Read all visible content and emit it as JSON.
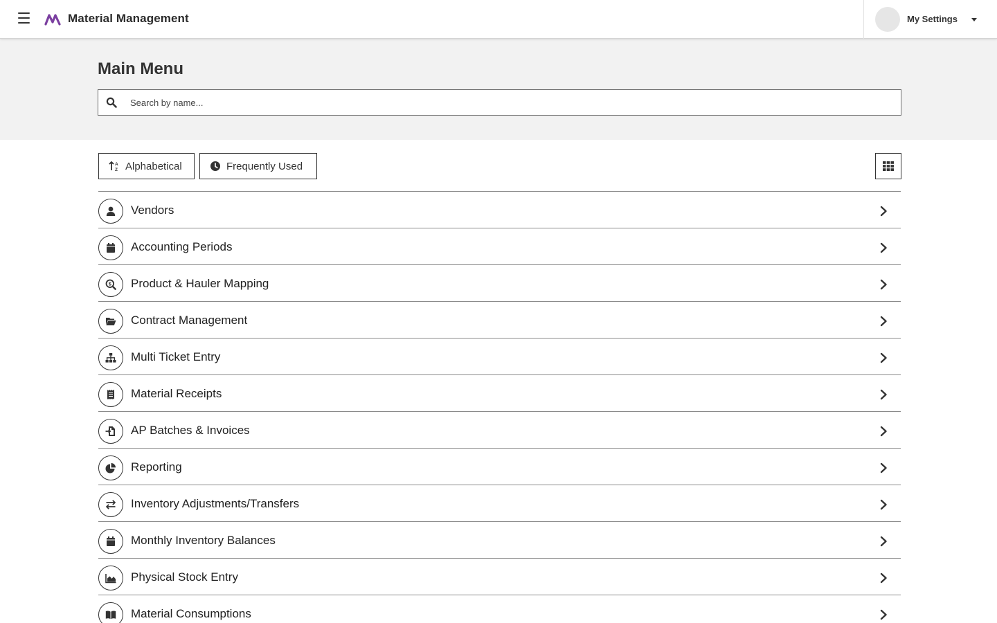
{
  "header": {
    "app_title": "Material Management",
    "settings_label": "My Settings",
    "logo_color": "#7b3fa0"
  },
  "hero": {
    "page_title": "Main Menu",
    "search_placeholder": "Search by name..."
  },
  "toolbar": {
    "alphabetical_label": "Alphabetical",
    "frequently_used_label": "Frequently Used"
  },
  "menu_items": [
    {
      "label": "Vendors",
      "icon": "user-icon"
    },
    {
      "label": "Accounting Periods",
      "icon": "calendar-icon"
    },
    {
      "label": "Product & Hauler Mapping",
      "icon": "search-dollar-icon"
    },
    {
      "label": "Contract Management",
      "icon": "folder-open-icon"
    },
    {
      "label": "Multi Ticket Entry",
      "icon": "sitemap-icon"
    },
    {
      "label": "Material Receipts",
      "icon": "receipt-icon"
    },
    {
      "label": "AP Batches & Invoices",
      "icon": "file-import-icon"
    },
    {
      "label": "Reporting",
      "icon": "chart-pie-icon"
    },
    {
      "label": "Inventory Adjustments/Transfers",
      "icon": "exchange-icon"
    },
    {
      "label": "Monthly Inventory Balances",
      "icon": "calendar-icon"
    },
    {
      "label": "Physical Stock Entry",
      "icon": "chart-area-icon"
    },
    {
      "label": "Material Consumptions",
      "icon": "book-open-icon"
    }
  ]
}
